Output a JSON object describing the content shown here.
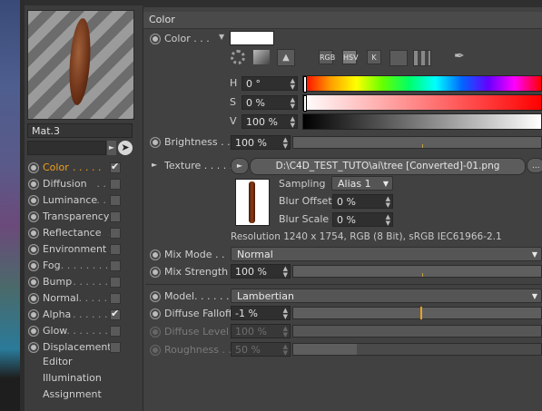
{
  "material": {
    "name": "Mat.3",
    "search_value": ""
  },
  "sidebar": {
    "items": [
      {
        "label": "Color",
        "checked": true,
        "active": true
      },
      {
        "label": "Diffusion",
        "checked": false
      },
      {
        "label": "Luminance",
        "checked": false
      },
      {
        "label": "Transparency",
        "checked": false
      },
      {
        "label": "Reflectance",
        "checked": false
      },
      {
        "label": "Environment",
        "checked": false
      },
      {
        "label": "Fog",
        "checked": false
      },
      {
        "label": "Bump",
        "checked": false
      },
      {
        "label": "Normal",
        "checked": false
      },
      {
        "label": "Alpha",
        "checked": true
      },
      {
        "label": "Glow",
        "checked": false
      },
      {
        "label": "Displacement",
        "checked": false
      }
    ],
    "extra_items": [
      "Editor",
      "Illumination",
      "Assignment"
    ]
  },
  "panel": {
    "title": "Color",
    "color_label": "Color . . .",
    "color_swatch": "#ffffff",
    "mode_buttons": [
      "RGB",
      "HSV",
      "K"
    ],
    "hsv": {
      "h_label": "H",
      "h_value": "0 °",
      "s_label": "S",
      "s_value": "0 %",
      "v_label": "V",
      "v_value": "100 %"
    },
    "brightness_label": "Brightness . .",
    "brightness_value": "100 %",
    "texture_label": "Texture . . . . .",
    "texture_path": "D:\\C4D_TEST_TUTO\\ai\\tree [Converted]-01.png",
    "sampling_label": "Sampling",
    "sampling_value": "Alias 1",
    "blur_offset_label": "Blur Offset",
    "blur_offset_value": "0 %",
    "blur_scale_label": "Blur Scale",
    "blur_scale_value": "0 %",
    "resolution_text": "Resolution 1240 x 1754, RGB (8 Bit), sRGB IEC61966-2.1",
    "mix_mode_label": "Mix Mode . .",
    "mix_mode_value": "Normal",
    "mix_strength_label": "Mix Strength",
    "mix_strength_value": "100 %",
    "model_label": "Model. . . . . .",
    "model_value": "Lambertian",
    "diffuse_falloff_label": "Diffuse Falloff",
    "diffuse_falloff_value": "-1 %",
    "diffuse_level_label": "Diffuse Level",
    "diffuse_level_value": "100 %",
    "roughness_label": "Roughness . .",
    "roughness_value": "50 %"
  },
  "colors": {
    "accent": "#f0a020",
    "active_label": "#f0a020"
  }
}
